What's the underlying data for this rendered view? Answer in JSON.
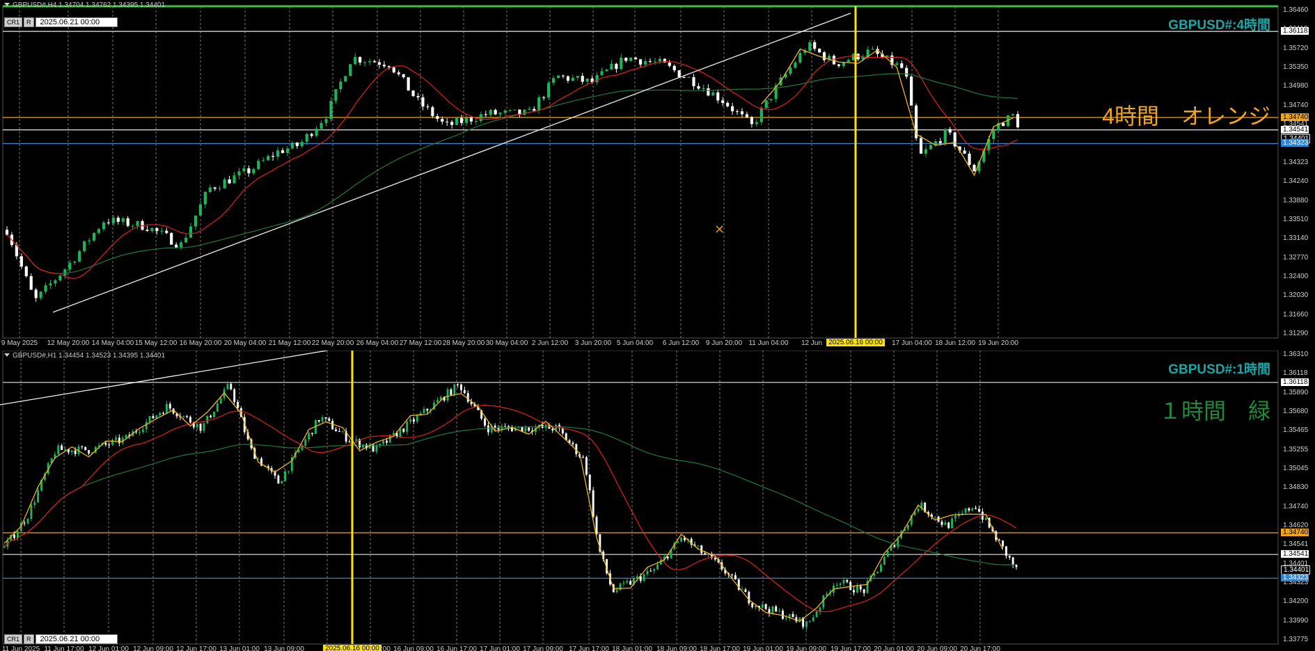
{
  "colors": {
    "bull": "#1fb35a",
    "bear": "#ffffff",
    "ma_fast": "#e0211b",
    "ma_slow": "#1f7a3f",
    "zigzag": "#f2b51b",
    "hline_white": "#e8e8e8",
    "hline_orange": "#f0a31c",
    "hline_blue": "#2f86d6",
    "vline": "#ffe400",
    "grid": "#7a7a7a"
  },
  "h4": {
    "header": "GBPUSD#,H4  1.34704 1.34762 1.34395 1.34401",
    "title": "GBPUSD#:4時間",
    "note": "4時間　オレンジ",
    "buttons": [
      "CR1",
      "R"
    ],
    "date_box": "2025.06.21 00:00",
    "price_axis": [
      "1.36460",
      "1.36118",
      "1.35720",
      "1.35350",
      "1.34980",
      "1.34740",
      "1.34541",
      "1.34401",
      "1.34323",
      "1.34240",
      "1.33880",
      "1.33510",
      "1.33140",
      "1.32770",
      "1.32400",
      "1.32030",
      "1.31660",
      "1.31290"
    ],
    "time_axis": [
      "9 May 2025",
      "12 May 20:00",
      "14 May 04:00",
      "15 May 12:00",
      "16 May 20:00",
      "20 May 04:00",
      "21 May 12:00",
      "22 May 20:00",
      "26 May 04:00",
      "27 May 12:00",
      "28 May 20:00",
      "30 May 04:00",
      "2 Jun 12:00",
      "3 Jun 20:00",
      "5 Jun 04:00",
      "6 Jun 12:00",
      "9 Jun 20:00",
      "11 Jun 04:00",
      "12 Jun",
      "17 Jun 04:00",
      "18 Jun 12:00",
      "19 Jun 20:00"
    ],
    "vline_label": "2025.06.16 00:00",
    "price_range": [
      1.3121,
      1.3652
    ],
    "hlines": {
      "white": 1.36118,
      "white2": 1.34541,
      "orange": 1.3474,
      "blue": 1.34323
    },
    "price_tags": [
      {
        "text": "1.36118",
        "price": 1.36118,
        "kind": "white"
      },
      {
        "text": "1.34740",
        "price": 1.3474,
        "kind": "orange"
      },
      {
        "text": "1.34541",
        "price": 1.34541,
        "kind": "white"
      },
      {
        "text": "1.34401",
        "price": 1.34401,
        "kind": "plain"
      },
      {
        "text": "1.34323",
        "price": 1.34323,
        "kind": "blue"
      }
    ]
  },
  "h1": {
    "header": "GBPUSD#,H1  1.34454 1.34523 1.34395 1.34401",
    "title": "GBPUSD#:1時間",
    "note": "１時間　緑",
    "buttons": [
      "CR1",
      "R"
    ],
    "date_box": "2025.06.21 00:00",
    "price_axis": [
      "1.36310",
      "1.36118",
      "1.35890",
      "1.35680",
      "1.35465",
      "1.35255",
      "1.35045",
      "1.34830",
      "1.34740",
      "1.34620",
      "1.34541",
      "1.34401",
      "1.34323",
      "1.34200",
      "1.33990",
      "1.33775"
    ],
    "time_axis": [
      "11 Jun 2025",
      "11 Jun 17:00",
      "12 Jun 01:00",
      "12 Jun 09:00",
      "12 Jun 17:00",
      "13 Jun 01:00",
      "13 Jun 09:00",
      "13",
      "16 Jun 01:00",
      "16 Jun 09:00",
      "16 Jun 17:00",
      "17 Jun 01:00",
      "17 Jun 09:00",
      "17 Jun 17:00",
      "18 Jun 01:00",
      "18 Jun 09:00",
      "18 Jun 17:00",
      "19 Jun 01:00",
      "19 Jun 09:00",
      "19 Jun 17:00",
      "20 Jun 01:00",
      "20 Jun 09:00",
      "20 Jun 17:00"
    ],
    "vline_label": "2025.06.16 00:00",
    "price_range": [
      1.3372,
      1.3641
    ],
    "hlines": {
      "white": 1.36118,
      "white2": 1.34541,
      "orange": 1.3474,
      "blue": 1.34323
    },
    "price_tags": [
      {
        "text": "1.36118",
        "price": 1.36118,
        "kind": "white"
      },
      {
        "text": "1.34740",
        "price": 1.3474,
        "kind": "orange"
      },
      {
        "text": "1.34541",
        "price": 1.34541,
        "kind": "white"
      },
      {
        "text": "1.34401",
        "price": 1.34401,
        "kind": "plain"
      },
      {
        "text": "1.34323",
        "price": 1.34323,
        "kind": "blue"
      }
    ]
  }
}
